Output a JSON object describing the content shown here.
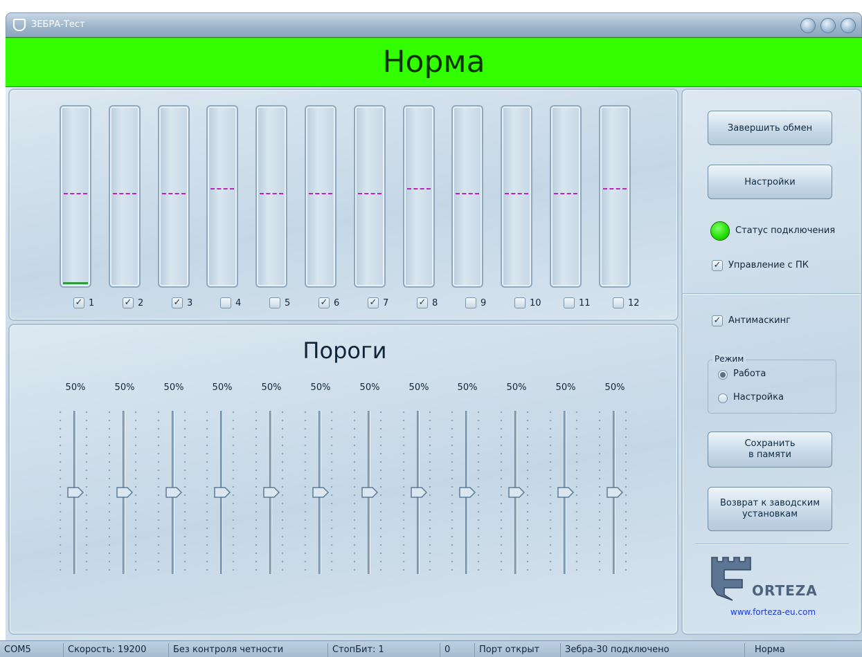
{
  "window": {
    "title": "ЗЕБРА-Тест"
  },
  "banner": {
    "status_text": "Норма",
    "color": "#33ff00"
  },
  "channels": [
    {
      "label": "1",
      "checked": true,
      "level": 0.49,
      "fill": 0.01
    },
    {
      "label": "2",
      "checked": true,
      "level": 0.49,
      "fill": 0
    },
    {
      "label": "3",
      "checked": true,
      "level": 0.49,
      "fill": 0
    },
    {
      "label": "4",
      "checked": false,
      "level": 0.46,
      "fill": 0
    },
    {
      "label": "5",
      "checked": false,
      "level": 0.49,
      "fill": 0
    },
    {
      "label": "6",
      "checked": true,
      "level": 0.49,
      "fill": 0
    },
    {
      "label": "7",
      "checked": true,
      "level": 0.49,
      "fill": 0
    },
    {
      "label": "8",
      "checked": true,
      "level": 0.46,
      "fill": 0
    },
    {
      "label": "9",
      "checked": false,
      "level": 0.49,
      "fill": 0
    },
    {
      "label": "10",
      "checked": false,
      "level": 0.49,
      "fill": 0
    },
    {
      "label": "11",
      "checked": false,
      "level": 0.49,
      "fill": 0
    },
    {
      "label": "12",
      "checked": false,
      "level": 0.46,
      "fill": 0
    }
  ],
  "thresholds": {
    "title": "Пороги",
    "items": [
      {
        "value": "50%",
        "fraction": 0.5
      },
      {
        "value": "50%",
        "fraction": 0.5
      },
      {
        "value": "50%",
        "fraction": 0.5
      },
      {
        "value": "50%",
        "fraction": 0.5
      },
      {
        "value": "50%",
        "fraction": 0.5
      },
      {
        "value": "50%",
        "fraction": 0.5
      },
      {
        "value": "50%",
        "fraction": 0.5
      },
      {
        "value": "50%",
        "fraction": 0.5
      },
      {
        "value": "50%",
        "fraction": 0.5
      },
      {
        "value": "50%",
        "fraction": 0.5
      },
      {
        "value": "50%",
        "fraction": 0.5
      },
      {
        "value": "50%",
        "fraction": 0.5
      }
    ]
  },
  "right_panel": {
    "finish_exchange": "Завершить обмен",
    "settings": "Настройки",
    "connection_status": "Статус подключения",
    "connection_color": "#22dd00",
    "pc_control": {
      "label": "Управление с ПК",
      "checked": true
    },
    "antimasking": {
      "label": "Антимаскинг",
      "checked": true
    },
    "mode": {
      "label": "Режим",
      "options": [
        {
          "label": "Работа",
          "selected": true
        },
        {
          "label": "Настройка",
          "selected": false
        }
      ]
    },
    "save_line1": "Сохранить",
    "save_line2": "в памяти",
    "reset_line1": "Возврат к заводским",
    "reset_line2": "установкам",
    "logo_word": "ORTEZA",
    "logo_url": "www.forteza-eu.com"
  },
  "statusbar": {
    "port": "COM5",
    "speed": "Скорость: 19200",
    "parity": "Без контроля четности",
    "stopbits": "СтопБит: 1",
    "counter": "0",
    "port_state": "Порт открыт",
    "device": "Зебра-30 подключено",
    "state": "Норма"
  }
}
